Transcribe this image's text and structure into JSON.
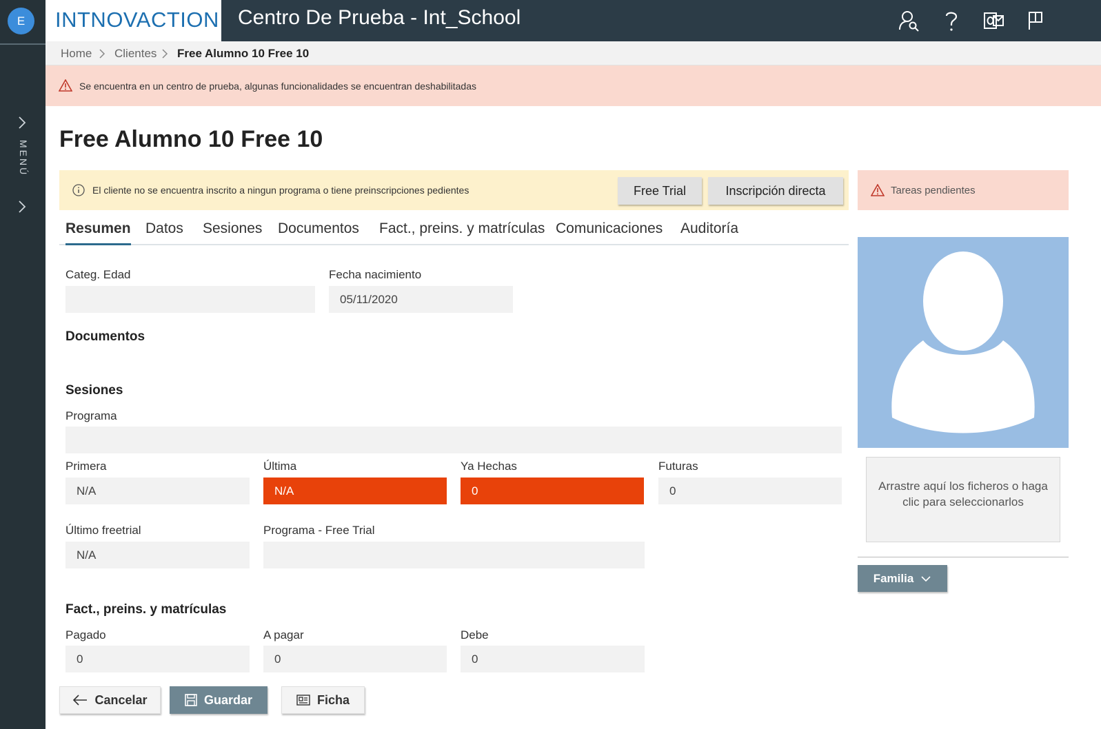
{
  "app": {
    "user_initial": "E",
    "logo_text": "INTNOVACTION",
    "title": "Centro De Prueba - Int_School",
    "menu_label": "MENÚ",
    "accent": "#2c6a8d"
  },
  "header_icons": [
    "user-search-icon",
    "help-icon",
    "outlook-icon",
    "flag-icon"
  ],
  "breadcrumb": {
    "items": [
      "Home",
      "Clientes",
      "Free Alumno 10 Free 10"
    ]
  },
  "warning_banner": {
    "text": "Se encuentra en un centro de prueba, algunas funcionalidades se encuentran deshabilitadas",
    "color": "#fad9cf"
  },
  "page": {
    "title": "Free Alumno 10 Free 10"
  },
  "info_bar": {
    "text": "El cliente no se encuentra inscrito a ningun programa o tiene preinscripciones pedientes",
    "free_trial_label": "Free Trial",
    "direct_enroll_label": "Inscripción directa"
  },
  "tasks": {
    "label": "Tareas pendientes"
  },
  "tabs": [
    {
      "label": "Resumen",
      "active": true
    },
    {
      "label": "Datos",
      "active": false
    },
    {
      "label": "Sesiones",
      "active": false
    },
    {
      "label": "Documentos",
      "active": false
    },
    {
      "label": "Fact., preins. y matrículas",
      "active": false
    },
    {
      "label": "Comunicaciones",
      "active": false
    },
    {
      "label": "Auditoría",
      "active": false
    }
  ],
  "resumen": {
    "categ_edad": {
      "label": "Categ. Edad",
      "value": ""
    },
    "fecha_nacimiento": {
      "label": "Fecha nacimiento",
      "value": "05/11/2020"
    },
    "documentos_title": "Documentos",
    "sesiones": {
      "title": "Sesiones",
      "programa": {
        "label": "Programa",
        "value": ""
      },
      "primera": {
        "label": "Primera",
        "value": "N/A"
      },
      "ultima": {
        "label": "Última",
        "value": "N/A"
      },
      "ya_hechas": {
        "label": "Ya Hechas",
        "value": "0"
      },
      "futuras": {
        "label": "Futuras",
        "value": "0"
      },
      "ultimo_freetrial": {
        "label": "Último freetrial",
        "value": "N/A"
      },
      "programa_free_trial": {
        "label": "Programa - Free Trial",
        "value": ""
      }
    },
    "facturacion": {
      "title": "Fact., preins. y matrículas",
      "pagado": {
        "label": "Pagado",
        "value": "0"
      },
      "a_pagar": {
        "label": "A pagar",
        "value": "0"
      },
      "debe": {
        "label": "Debe",
        "value": "0"
      }
    },
    "highlight_color": "#e8420a"
  },
  "sidebar_right": {
    "dropzone_text": "Arrastre aquí los ficheros o haga clic para seleccionarlos",
    "familia_label": "Familia"
  },
  "footer": {
    "cancel_label": "Cancelar",
    "save_label": "Guardar",
    "ficha_label": "Ficha"
  }
}
